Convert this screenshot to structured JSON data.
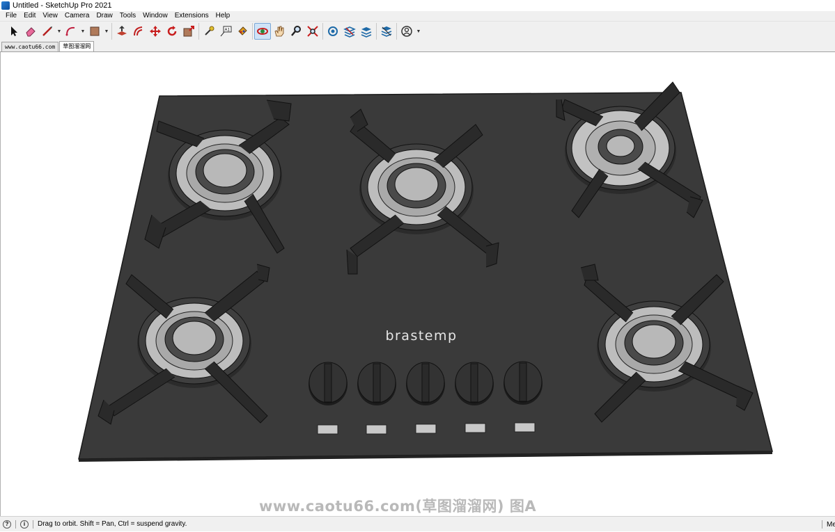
{
  "window": {
    "title": "Untitled - SketchUp Pro 2021"
  },
  "menu": [
    "File",
    "Edit",
    "View",
    "Camera",
    "Draw",
    "Tools",
    "Window",
    "Extensions",
    "Help"
  ],
  "toolbar": {
    "tools": [
      {
        "name": "select-icon"
      },
      {
        "name": "eraser-icon"
      },
      {
        "name": "line-icon",
        "dropdown": true
      },
      {
        "name": "arc-icon",
        "dropdown": true
      },
      {
        "name": "rectangle-icon",
        "dropdown": true
      },
      {
        "name": "push-pull-icon"
      },
      {
        "name": "offset-icon"
      },
      {
        "name": "move-icon"
      },
      {
        "name": "rotate-icon"
      },
      {
        "name": "scale-icon"
      },
      {
        "name": "tape-measure-icon"
      },
      {
        "name": "text-icon"
      },
      {
        "name": "paint-bucket-icon"
      },
      {
        "name": "orbit-icon",
        "active": true
      },
      {
        "name": "pan-icon"
      },
      {
        "name": "zoom-icon"
      },
      {
        "name": "zoom-extents-icon"
      },
      {
        "name": "3d-warehouse-icon"
      },
      {
        "name": "extension-warehouse-icon"
      },
      {
        "name": "layout-icon"
      },
      {
        "name": "extension-manager-icon"
      },
      {
        "name": "account-icon",
        "dropdown": true
      }
    ]
  },
  "tabs": [
    {
      "label": "www.caotu66.com",
      "active": false
    },
    {
      "label": "草图溜溜网",
      "active": true
    }
  ],
  "model": {
    "brand_label": "brastemp",
    "colors": {
      "cooktop": "#3a3a3a",
      "burner_light": "#b5b5b5",
      "burner_dark": "#4a4a4a",
      "grate": "#2a2a2a",
      "knob": "#333333",
      "plate": "#c8c8c8"
    }
  },
  "watermark": "www.caotu66.com(草图溜溜网) 图A",
  "status": {
    "message": "Drag to orbit. Shift = Pan, Ctrl = suspend gravity.",
    "right_label": "Me"
  }
}
